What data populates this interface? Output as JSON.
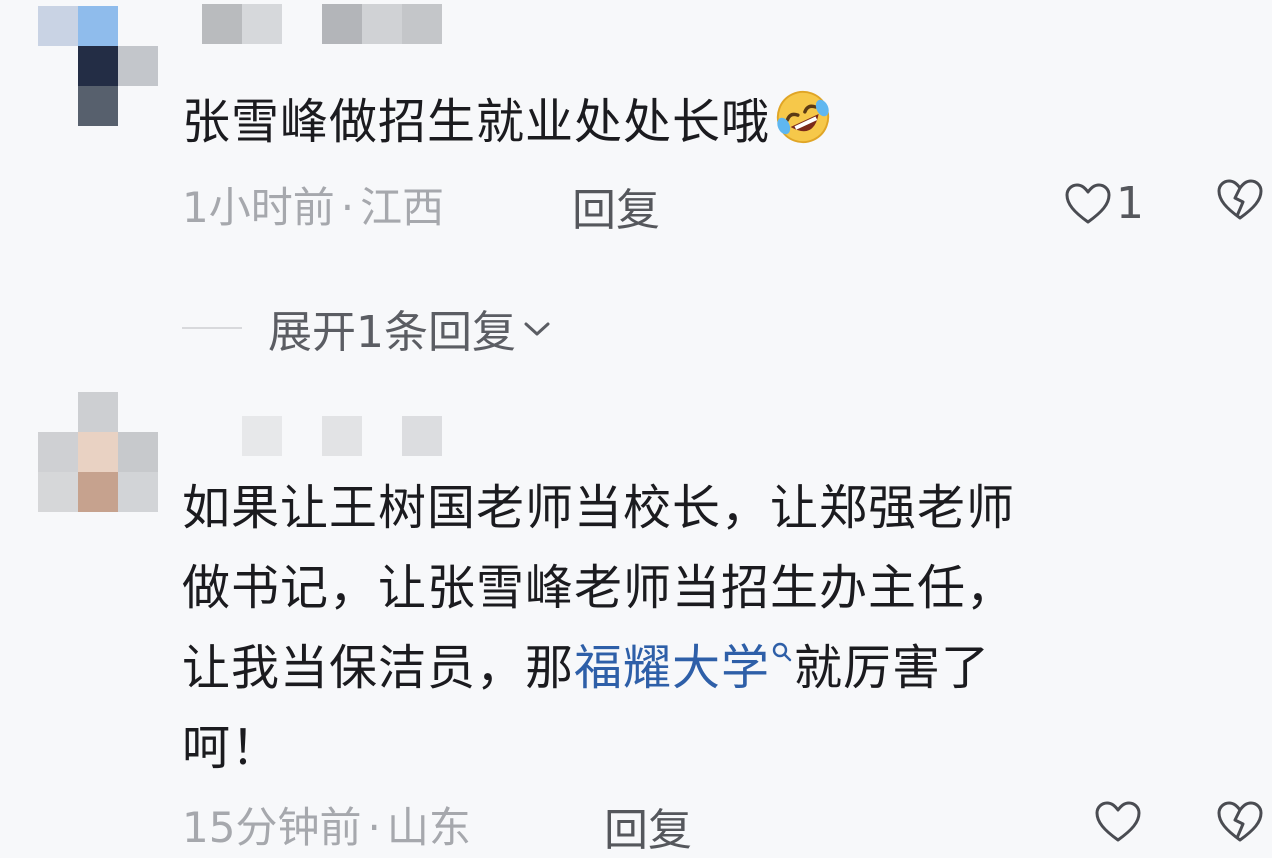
{
  "comments": [
    {
      "avatar_pixels": [
        "#c9d3e4",
        "#8fbcec",
        "#f7f8fa",
        "#f7f8fa",
        "#232d45",
        "#c3c6cb",
        "#f7f8fa",
        "#57606d",
        "#f7f8fa"
      ],
      "username_pixels": [
        "#b9bbbe",
        "#d6d8db",
        "#f7f8fa",
        "#b3b5b9",
        "#d0d2d5",
        "#c4c6c9"
      ],
      "text": "张雪峰做招生就业处处长哦",
      "emoji": "rolling-on-floor-laughing-emoji",
      "time": "1小时前",
      "location": "江西",
      "reply_label": "回复",
      "like_count": "1",
      "expand_label": "展开1条回复"
    },
    {
      "avatar_pixels": [
        "#f7f8fa",
        "#cdcfd2",
        "#f7f8fa",
        "#cfd0d3",
        "#e9d2c3",
        "#c7c9cc",
        "#d6d7d9",
        "#c6a28e",
        "#d2d4d7"
      ],
      "username_pixels": [
        "#e7e8ea",
        "#f7f8fa",
        "#e2e3e5",
        "#f7f8fa",
        "#dcdde0"
      ],
      "text_lines": [
        "如果让王树国老师当校长，让郑强老师",
        "做书记，让张雪峰老师当招生办主任，"
      ],
      "text_line3_before": "让我当保洁员，那",
      "text_link": "福耀大学",
      "text_line3_after": "就厉害了",
      "text_line4": "呵！",
      "time": "15分钟前",
      "location": "山东",
      "reply_label": "回复"
    }
  ],
  "colors": {
    "background": "#f7f8fa",
    "text": "#1b1b1f",
    "meta": "#a6a8ad",
    "link": "#2e5fa8"
  }
}
